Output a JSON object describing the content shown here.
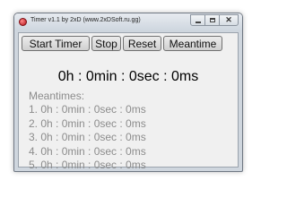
{
  "window": {
    "title": "Timer v1.1 by 2xD (www.2xDSoft.ru.gg)"
  },
  "toolbar": {
    "start_label": "Start Timer",
    "stop_label": "Stop",
    "reset_label": "Reset",
    "meantime_label": "Meantime"
  },
  "timer": {
    "display": "0h : 0min : 0sec : 0ms"
  },
  "meantimes": {
    "heading": "Meantimes:",
    "items": [
      "1. 0h : 0min : 0sec : 0ms",
      "2. 0h : 0min : 0sec : 0ms",
      "3. 0h : 0min : 0sec : 0ms",
      "4. 0h : 0min : 0sec : 0ms",
      "5. 0h : 0min : 0sec : 0ms"
    ]
  },
  "icons": {
    "app": "app-icon",
    "minimize": "minimize-icon",
    "maximize": "maximize-icon",
    "close": "close-icon"
  }
}
